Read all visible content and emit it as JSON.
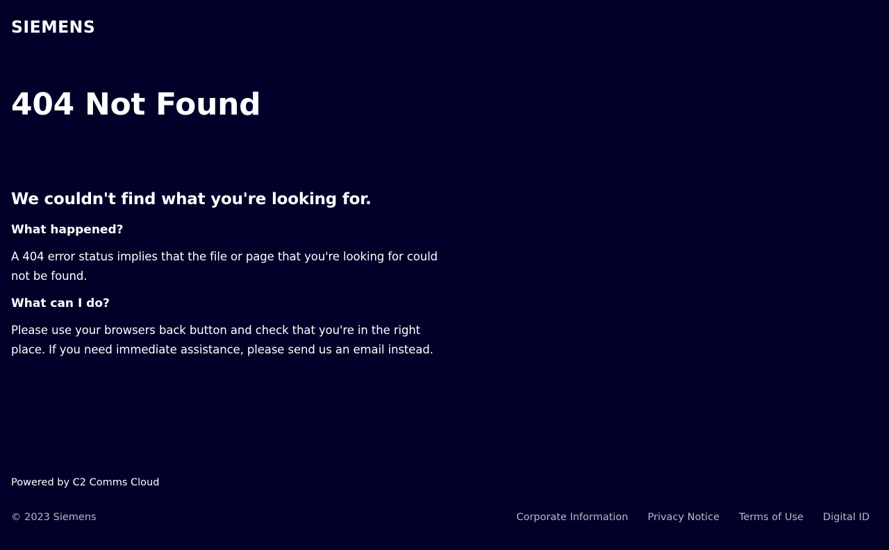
{
  "brand": {
    "logo_text": "SIEMENS"
  },
  "main": {
    "title": "404 Not Found",
    "subtitle": "We couldn't find what you're looking for.",
    "sections": [
      {
        "heading": "What happened?",
        "body": "A 404 error status implies that the file or page that you're looking for could not be found."
      },
      {
        "heading": "What can I do?",
        "body": "Please use your browsers back button and check that you're in the right place. If you need immediate assistance, please send us an email instead."
      }
    ]
  },
  "powered_by": "Powered by C2 Comms Cloud",
  "footer": {
    "copyright": "© 2023 Siemens",
    "links": [
      "Corporate Information",
      "Privacy Notice",
      "Terms of Use",
      "Digital ID"
    ]
  },
  "colors": {
    "background": "#000028",
    "text": "#ffffff",
    "muted_text": "#b9b9c8"
  }
}
